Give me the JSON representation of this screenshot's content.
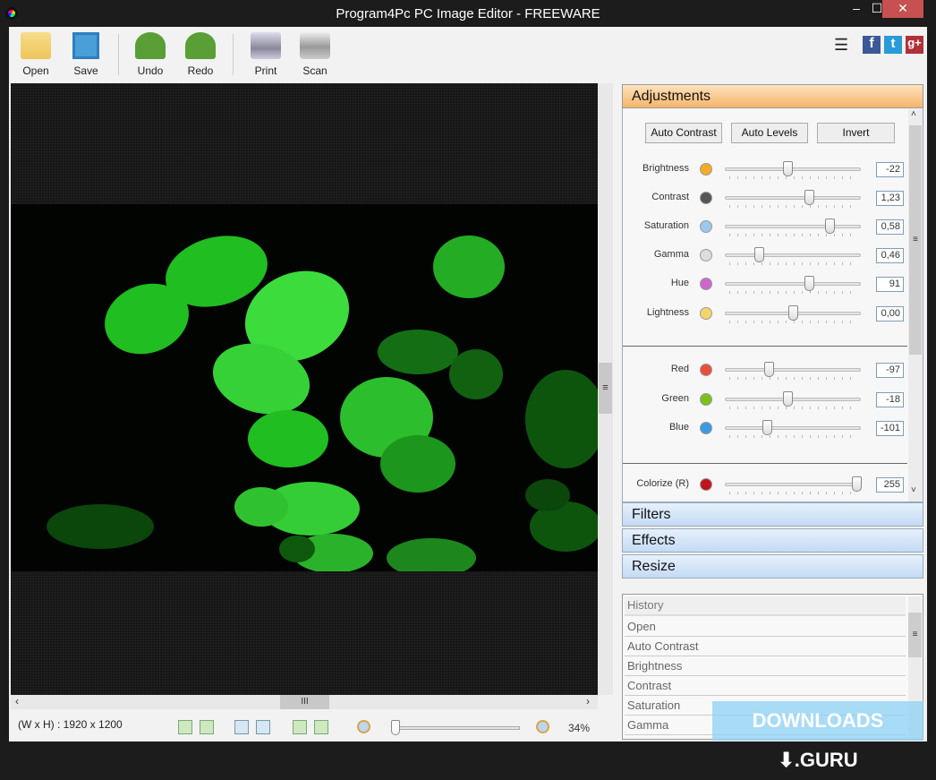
{
  "window": {
    "title": "Program4Pc PC Image Editor - FREEWARE",
    "minimize": "–",
    "maximize": "☐",
    "close": "✕"
  },
  "toolbar": {
    "open": "Open",
    "save": "Save",
    "undo": "Undo",
    "redo": "Redo",
    "print": "Print",
    "scan": "Scan"
  },
  "social": {
    "menu": "☰",
    "facebook": "f",
    "twitter": "t",
    "google": "g+"
  },
  "colors": {
    "adjustments_header": "#f6b56b",
    "panel_header": "#c4dbf4",
    "close": "#c75050",
    "leaf": "#2fd82f"
  },
  "adjustments": {
    "title": "Adjustments",
    "auto_contrast": "Auto Contrast",
    "auto_levels": "Auto Levels",
    "invert": "Invert",
    "rows": [
      {
        "label": "Brightness",
        "value": "-22",
        "position": 0.46,
        "icon": "sun-icon",
        "color": "#f7a928"
      },
      {
        "label": "Contrast",
        "value": "1,23",
        "position": 0.62,
        "icon": "contrast-icon",
        "color": "#555"
      },
      {
        "label": "Saturation",
        "value": "0,58",
        "position": 0.77,
        "icon": "saturation-icon",
        "color": "#9cc8ee"
      },
      {
        "label": "Gamma",
        "value": "0,46",
        "position": 0.25,
        "icon": "gamma-icon",
        "color": "#ddd"
      },
      {
        "label": "Hue",
        "value": "91",
        "position": 0.62,
        "icon": "color-wheel-icon",
        "color": "#c6c"
      },
      {
        "label": "Lightness",
        "value": "0,00",
        "position": 0.5,
        "icon": "lightbulb-icon",
        "color": "#f5d56a"
      },
      {
        "label": "Red",
        "value": "-97",
        "position": 0.32,
        "icon": "red-dot-icon",
        "color": "#e8503c"
      },
      {
        "label": "Green",
        "value": "-18",
        "position": 0.46,
        "icon": "green-dot-icon",
        "color": "#7cc01e"
      },
      {
        "label": "Blue",
        "value": "-101",
        "position": 0.31,
        "icon": "blue-dot-icon",
        "color": "#3e9ae0"
      },
      {
        "label": "Colorize (R)",
        "value": "255",
        "position": 0.97,
        "icon": "down-arrow-icon",
        "color": "#c0141c"
      }
    ]
  },
  "panels": {
    "filters": "Filters",
    "effects": "Effects",
    "resize": "Resize"
  },
  "history": {
    "header": "History",
    "items": [
      "Open",
      "Auto Contrast",
      "Brightness",
      "Contrast",
      "Saturation",
      "Gamma"
    ]
  },
  "status": {
    "dimensions": "(W x H) : 1920 x 1200",
    "zoom": "34%",
    "zoom_position": 0.03
  },
  "watermark": "DOWNLOADS ⬇.GURU"
}
